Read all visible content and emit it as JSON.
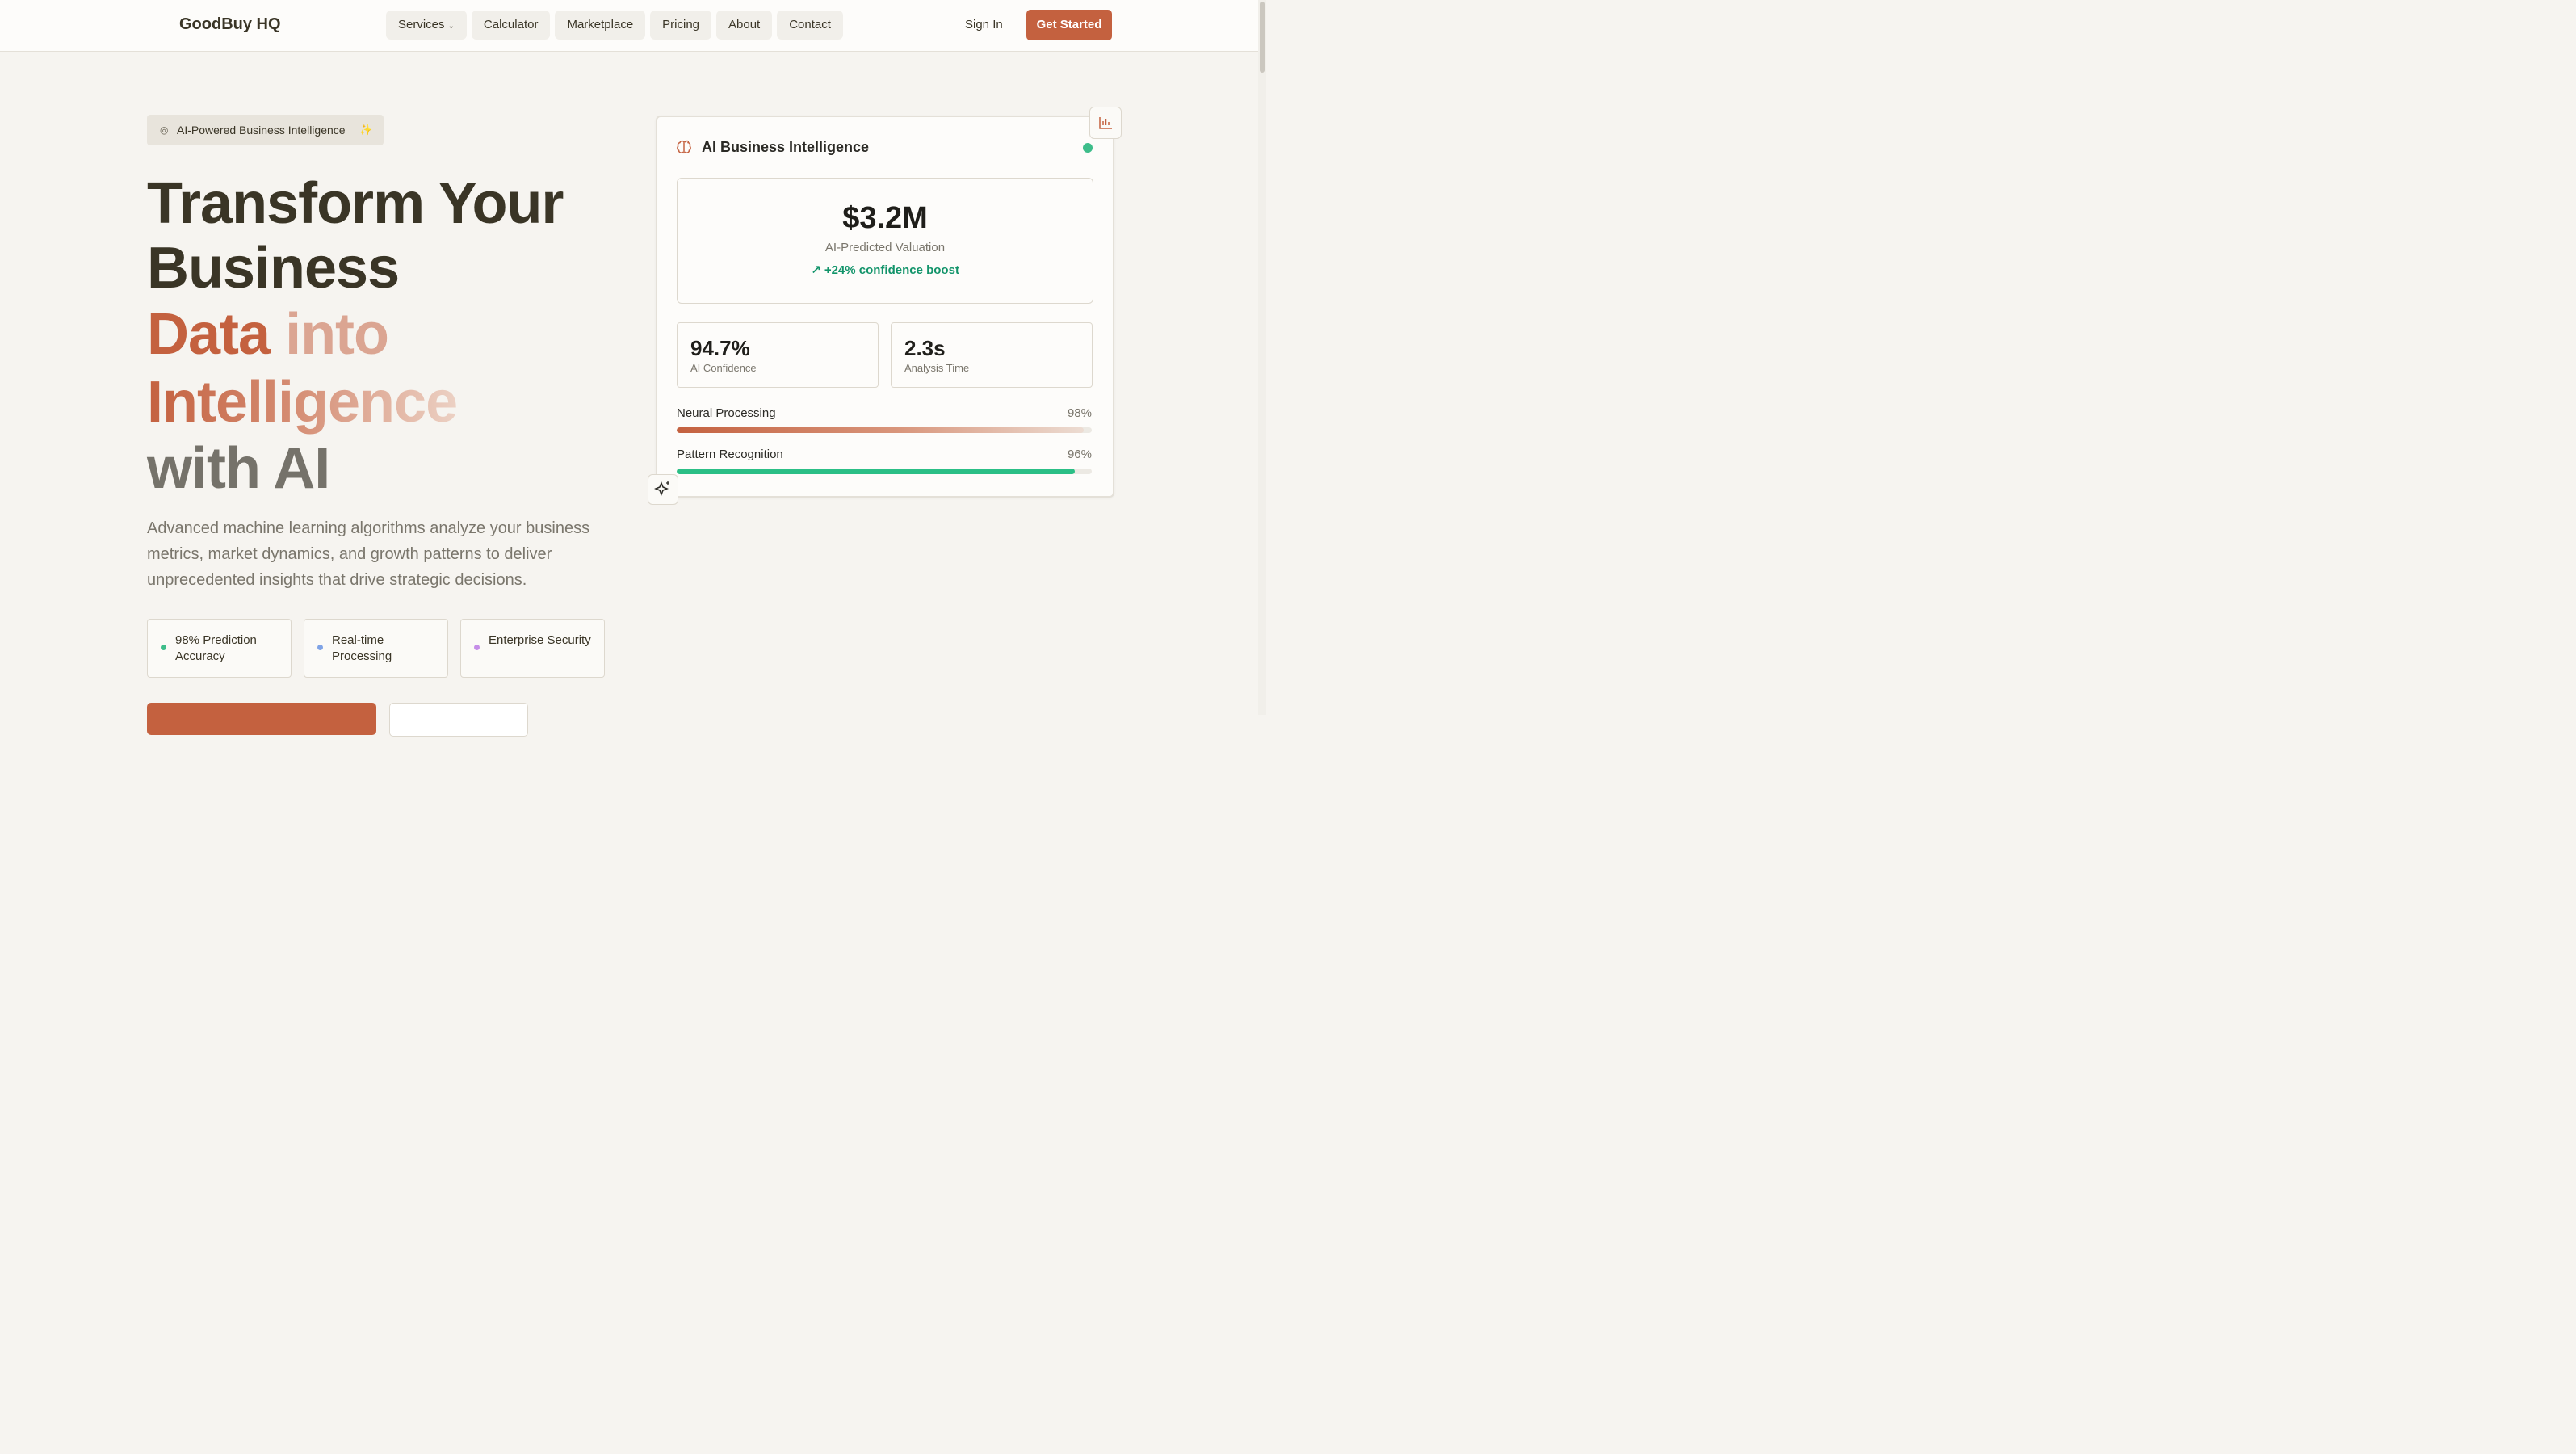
{
  "nav": {
    "logo": "GoodBuy HQ",
    "links": [
      "Services",
      "Calculator",
      "Marketplace",
      "Pricing",
      "About",
      "Contact"
    ],
    "sign_in": "Sign In",
    "get_started": "Get Started"
  },
  "hero": {
    "badge": "AI-Powered Business Intelligence",
    "headline_line1": "Transform Your",
    "headline_line2": "Business",
    "headline_line3_a": "Data ",
    "headline_line3_b": "into",
    "headline_line4": "Intelligence",
    "headline_line5": "with AI",
    "subtitle": "Advanced machine learning algorithms analyze your business metrics, market dynamics, and growth patterns to deliver unprecedented insights that drive strategic decisions.",
    "features": [
      {
        "label": "98% Prediction Accuracy",
        "color": "#3dbd8a"
      },
      {
        "label": "Real-time Processing",
        "color": "#7fa3e6"
      },
      {
        "label": "Enterprise Security",
        "color": "#c58ee8"
      }
    ]
  },
  "card": {
    "title": "AI Business Intelligence",
    "valuation": "$3.2M",
    "valuation_label": "AI-Predicted Valuation",
    "boost": "+24% confidence boost",
    "stats": [
      {
        "value": "94.7%",
        "label": "AI Confidence"
      },
      {
        "value": "2.3s",
        "label": "Analysis Time"
      }
    ],
    "bars": [
      {
        "label": "Neural Processing",
        "percent": "98%",
        "value": 98
      },
      {
        "label": "Pattern Recognition",
        "percent": "96%",
        "value": 96
      }
    ]
  },
  "colors": {
    "accent": "#c4613f",
    "success": "#12946a",
    "online": "#3dbd8a"
  }
}
